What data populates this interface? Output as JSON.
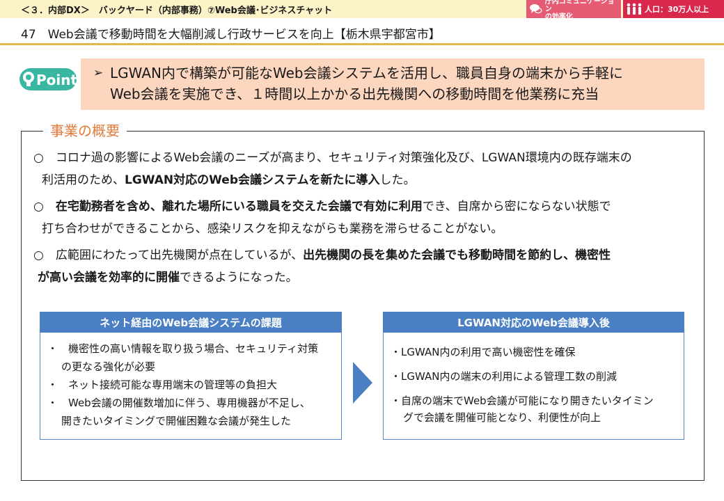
{
  "header": {
    "section_label": "＜３．内部DX＞　バックヤード（内部事務）⑦Web会議･ビジネスチャット",
    "tag_comm_line1": "庁内コミュニケーション",
    "tag_comm_line2": "の効率化",
    "tag_population": "人口：30万人以上",
    "accent_color": "#e45b73",
    "population_color": "#d8284b"
  },
  "case_title": "47　Web会議で移動時間を大幅削減し行政サービスを向上【栃木県宇都宮市】",
  "point": {
    "logo_text": "Point",
    "arrow": "➢",
    "line1": "LGWAN内で構築が可能なWeb会議システムを活用し、職員自身の端末から手軽に",
    "line2": "Web会議を実施でき、１時間以上かかる出先機関への移動時間を他業務に充当",
    "bg_color": "#fcd6bf"
  },
  "overview": {
    "title": "事業の概要",
    "p1": {
      "line1": "○　コロナ過の影響によるWeb会議のニーズが高まり、セキュリティ対策強化及び、LGWAN環境内の既存端末の",
      "line2_a": "利活用のため、",
      "line2_b": "LGWAN対応のWeb会議システムを新たに導入",
      "line2_c": "した。"
    },
    "p2": {
      "line1_a": "○　",
      "line1_b": "在宅勤務者を含め、離れた場所にいる職員を交えた会議で有効に利用",
      "line1_c": "でき、自席から密にならない状態で",
      "line2": "打ち合わせができることから、感染リスクを抑えながらも業務を滞らせることがない。"
    },
    "p3": {
      "line1_a": "○　広範囲にわたって出先機関が点在しているが、",
      "line1_b": "出先機関の長を集めた会議でも移動時間を節約し、機密性",
      "line2_a": "が高い会議を効率的に開催",
      "line2_b": "できるようになった。"
    }
  },
  "comparison": {
    "before": {
      "title": "ネット経由のWeb会議システムの課題",
      "item1_l1": "・　機密性の高い情報を取り扱う場合、セキュリティ対策",
      "item1_l2": "の更なる強化が必要",
      "item2": "・　ネット接続可能な専用端末の管理等の負担大",
      "item3_l1": "・　Web会議の開催数増加に伴う、専用機器が不足し、",
      "item3_l2": "開きたいタイミングで開催困難な会議が発生した"
    },
    "after": {
      "title": "LGWAN対応のWeb会議導入後",
      "item1": "・LGWAN内の利用で高い機密性を確保",
      "item2": "・LGWAN内の端末の利用による管理工数の削減",
      "item3_l1": "・自席の端末でWeb会議が可能になり開きたいタイミン",
      "item3_l2": "グで会議を開催可能となり、利便性が向上"
    },
    "header_color": "#4a7fc4",
    "arrow_icon": "chevron-right-arrow-icon"
  }
}
